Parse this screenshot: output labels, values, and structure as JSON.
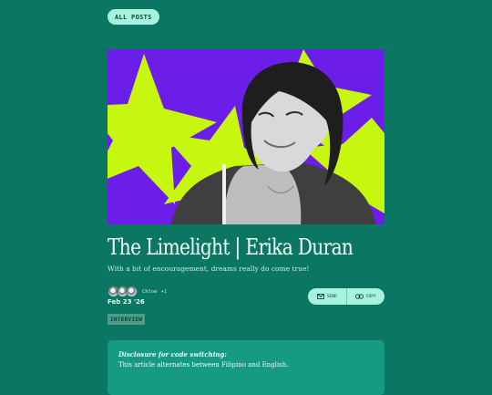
{
  "nav": {
    "all_posts_label": "ALL POSTS"
  },
  "hero": {
    "image_icon": "portrait-photo",
    "colors": {
      "background": "#6a1ee8",
      "stars": "#c8f70f"
    }
  },
  "post": {
    "title": "The Limelight | Erika Duran",
    "subtitle": "With a bit of encouragement, dreams really do come true!",
    "authors": {
      "names": "Chloe",
      "more": "+1"
    },
    "date": "Feb 23 '26",
    "tag": "INTERVIEW"
  },
  "share": {
    "send_label": "SEND",
    "send_icon": "mail-icon",
    "copy_label": "COPY",
    "copy_icon": "link-icon"
  },
  "disclosure": {
    "title": "Disclosure for code switching:",
    "text": "This article alternates between Filipino and English."
  },
  "theme": {
    "background": "#0b7763",
    "accent": "#a7f3df"
  }
}
